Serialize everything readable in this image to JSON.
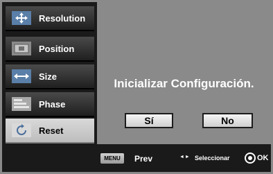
{
  "menu": {
    "items": [
      {
        "label": "Resolution",
        "icon": "resolution-arrows-icon"
      },
      {
        "label": "Position",
        "icon": "position-screen-icon"
      },
      {
        "label": "Size",
        "icon": "size-width-icon"
      },
      {
        "label": "Phase",
        "icon": "phase-bars-icon"
      },
      {
        "label": "Reset",
        "icon": "reset-circular-arrow-icon",
        "selected": true
      }
    ]
  },
  "dialog": {
    "prompt": "Inicializar Configuración.",
    "yes_label": "Sí",
    "no_label": "No"
  },
  "footer": {
    "menu_key": "MENU",
    "prev_label": "Prev",
    "arrows_glyph": "◄►",
    "select_label": "Seleccionar",
    "ok_label": "OK"
  },
  "colors": {
    "background": "#8a8a8a",
    "sidebar": "#1a1a1a",
    "selected_item": "#cfcfcf"
  }
}
